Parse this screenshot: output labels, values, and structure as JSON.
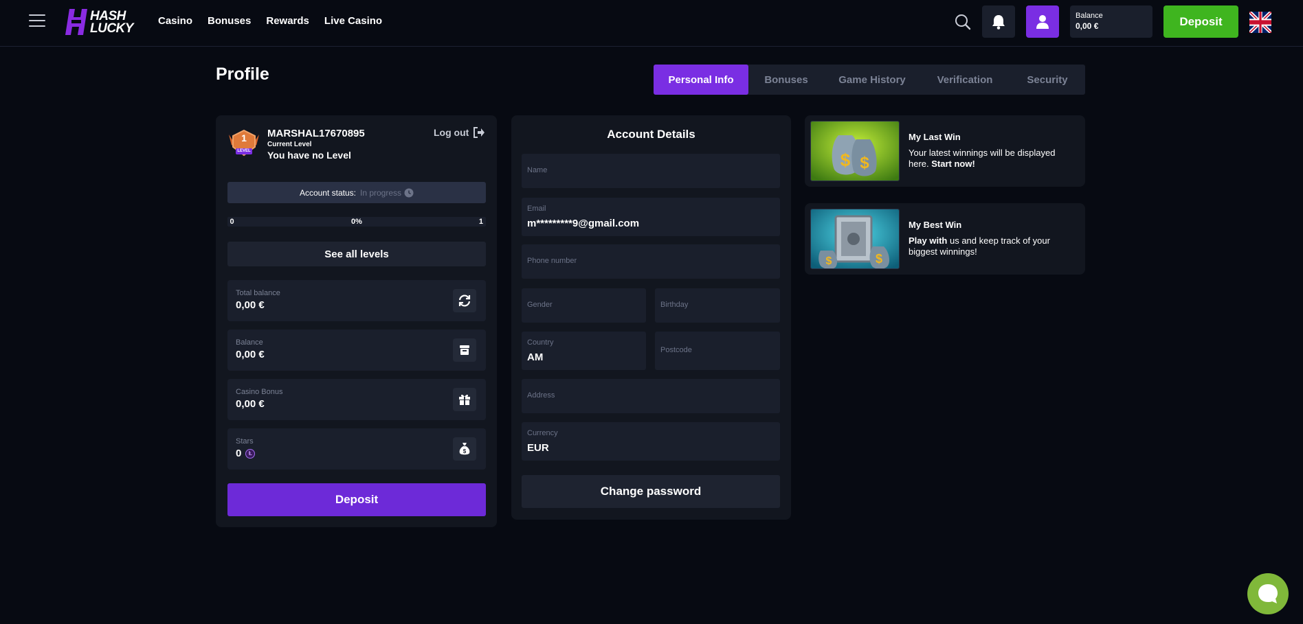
{
  "header": {
    "logo_text_line1": "HASH",
    "logo_text_line2": "LUCKY",
    "nav": [
      "Casino",
      "Bonuses",
      "Rewards",
      "Live Casino"
    ],
    "balance_label": "Balance",
    "balance_value": "0,00 €",
    "deposit_label": "Deposit"
  },
  "page": {
    "title": "Profile",
    "tabs": [
      "Personal Info",
      "Bonuses",
      "Game History",
      "Verification",
      "Security"
    ],
    "active_tab": "Personal Info"
  },
  "profile": {
    "badge_number": "1",
    "badge_text": "LEVEL",
    "username": "MARSHAL17670895",
    "current_level_label": "Current Level",
    "level_value": "You have no Level",
    "logout_label": "Log out",
    "account_status_label": "Account status:",
    "account_status_value": "In progress",
    "progress_start": "0",
    "progress_percent": "0%",
    "progress_end": "1",
    "see_levels_label": "See all levels",
    "stats": [
      {
        "label": "Total balance",
        "value": "0,00 €",
        "icon": "refresh-icon"
      },
      {
        "label": "Balance",
        "value": "0,00 €",
        "icon": "wallet-icon"
      },
      {
        "label": "Casino Bonus",
        "value": "0,00 €",
        "icon": "gift-icon"
      },
      {
        "label": "Stars",
        "value": "0",
        "icon": "money-bag-icon"
      }
    ],
    "coin_glyph": "Ƚ",
    "deposit_label": "Deposit"
  },
  "account": {
    "title": "Account Details",
    "name_label": "Name",
    "email_label": "Email",
    "email_value": "m*********9@gmail.com",
    "phone_label": "Phone number",
    "gender_label": "Gender",
    "birthday_label": "Birthday",
    "country_label": "Country",
    "country_value": "AM",
    "postcode_label": "Postcode",
    "address_label": "Address",
    "currency_label": "Currency",
    "currency_value": "EUR",
    "change_password_label": "Change password"
  },
  "wins": {
    "last_title": "My Last Win",
    "last_desc": "Your latest winnings will be displayed here.",
    "last_cta": "Start now!",
    "best_title": "My Best Win",
    "best_bold": "Play with",
    "best_desc": "us and keep track of your biggest winnings!"
  },
  "colors": {
    "accent": "#7a2ee3",
    "deposit_green": "#3fb51f",
    "chat_green": "#80b83a"
  }
}
